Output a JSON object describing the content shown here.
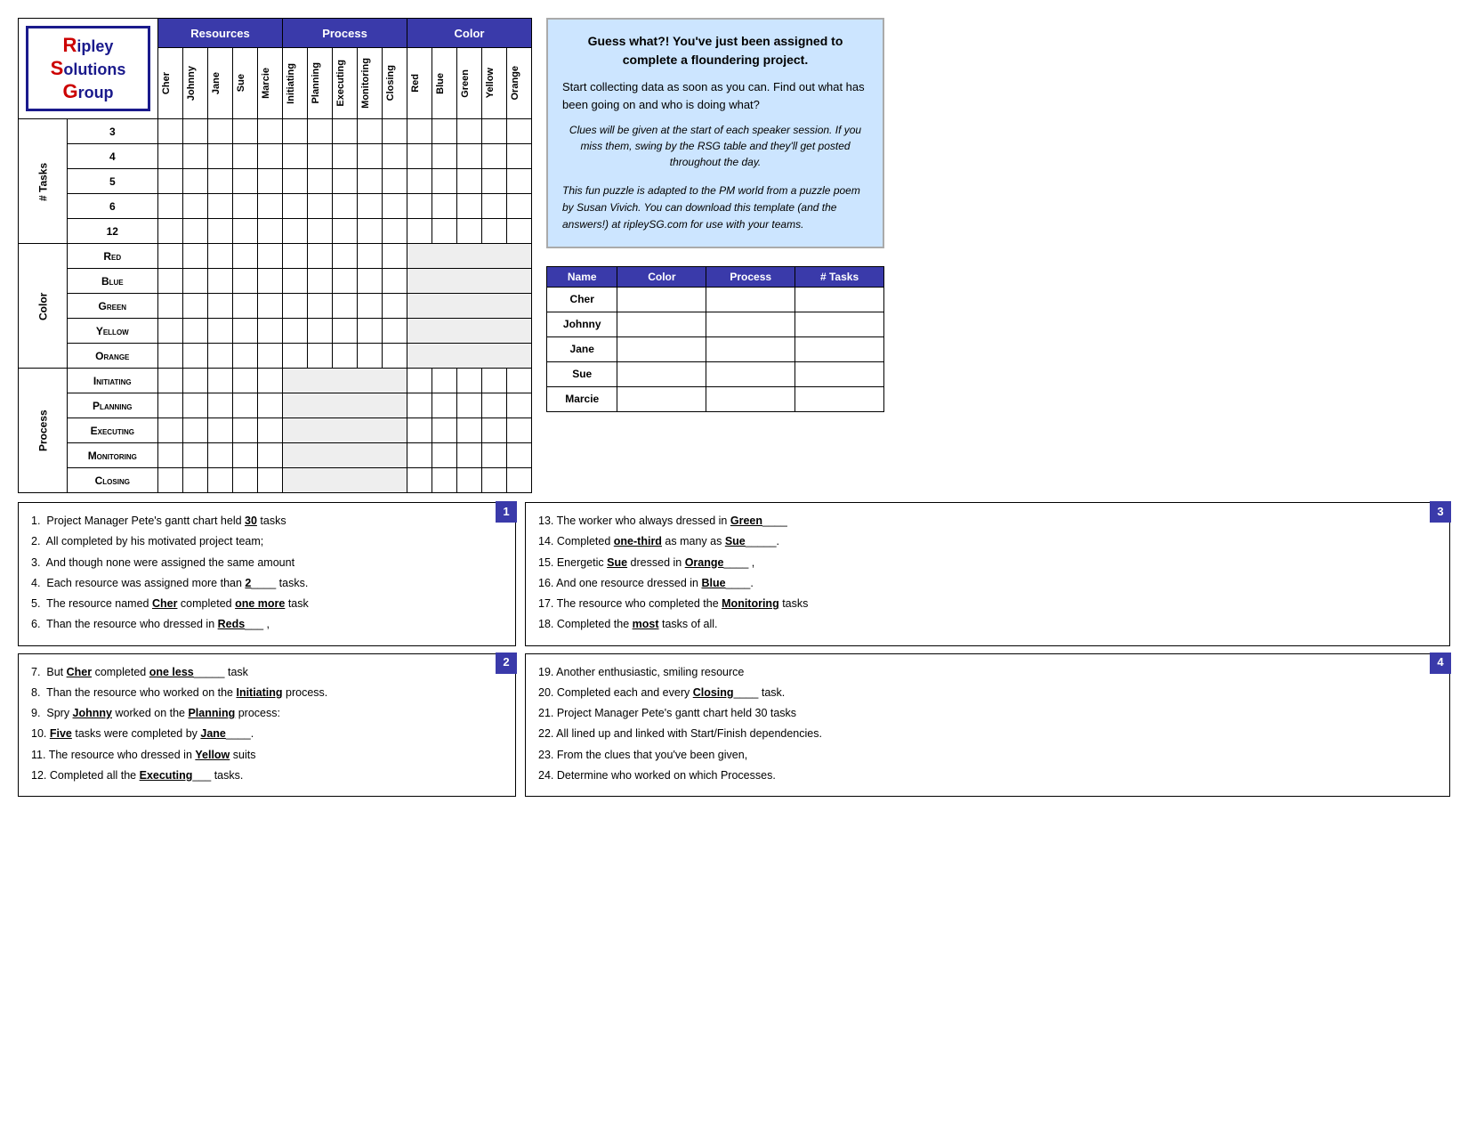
{
  "logo": {
    "r": "R",
    "line1": "ipley",
    "s": "S",
    "line2": "olutions",
    "g": "G",
    "line3": "roup"
  },
  "header": {
    "resources": "Resources",
    "process": "Process",
    "color": "Color"
  },
  "col_headers": {
    "resources": [
      "Cher",
      "Johnny",
      "Jane",
      "Sue",
      "Marcie"
    ],
    "process": [
      "Initiating",
      "Planning",
      "Executing",
      "Monitoring",
      "Closing"
    ],
    "color": [
      "Red",
      "Blue",
      "Green",
      "Yellow",
      "Orange"
    ]
  },
  "row_sections": {
    "tasks": {
      "label": "# Tasks",
      "rows": [
        "3",
        "4",
        "5",
        "6",
        "12"
      ]
    },
    "color": {
      "label": "Color",
      "rows": [
        "Red",
        "Blue",
        "Green",
        "Yellow",
        "Orange"
      ]
    },
    "process": {
      "label": "Process",
      "rows": [
        "Initiating",
        "Planning",
        "Executing",
        "Monitoring",
        "Closing"
      ]
    }
  },
  "info_box": {
    "title": "Guess what?! You've just been assigned to complete a floundering project.",
    "body": "Start collecting data as soon as you can.  Find out what has been going on and who is doing what?",
    "italic1": "Clues will be given at the start of each speaker session.  If you miss them, swing by the RSG table and they'll get posted throughout the day.",
    "note": "This fun puzzle is adapted to the PM world from a puzzle poem by Susan Vivich.  You can download this template (and the answers!) at ripleySG.com for use with your teams."
  },
  "summary_table": {
    "headers": [
      "Name",
      "Color",
      "Process",
      "# Tasks"
    ],
    "rows": [
      {
        "name": "Cher"
      },
      {
        "name": "Johnny"
      },
      {
        "name": "Jane"
      },
      {
        "name": "Sue"
      },
      {
        "name": "Marcie"
      }
    ]
  },
  "clues": {
    "box1": {
      "number": "1",
      "lines": [
        "1.  Project Manager Pete's gantt chart held __30__ tasks",
        "2.  All completed by his motivated project team;",
        "3.  And though none were assigned the same amount",
        "4.  Each resource was assigned more than __2____ tasks.",
        "5.  The resource named __Cher__ completed _one more_ task",
        "6.  Than the resource who dressed in __Reds___ ,"
      ]
    },
    "box2": {
      "number": "2",
      "lines": [
        "7.  But __Cher_ completed _one less_____ task",
        "8.  Than the resource who worked on the _Initiating_ process.",
        "9.  Spry __Johnny__ worked on the _Planning_ process:",
        "10. _Five_ tasks were completed by _Jane____.",
        "11. The resource who dressed in _Yellow_ suits",
        "12. Completed all the _Executing___ tasks."
      ]
    },
    "box3": {
      "number": "3",
      "lines": [
        "13. The worker who always dressed in _Green____",
        "14. Completed _one-third_ as many as _Sue_____.",
        "15. Energetic _Sue__ dressed in _Orange____ ,",
        "16. And one resource dressed in _Blue____.",
        "17. The resource who completed the __Monitoring_ tasks",
        "18. Completed the _most_ tasks of all."
      ]
    },
    "box4": {
      "number": "4",
      "lines": [
        "19. Another enthusiastic, smiling resource",
        "20. Completed each and every _Closing____ task.",
        "21. Project Manager Pete's gantt chart held 30 tasks",
        "22. All lined up and linked with Start/Finish dependencies.",
        "23. From the clues that you've been given,",
        "24. Determine who worked on which Processes."
      ]
    }
  }
}
